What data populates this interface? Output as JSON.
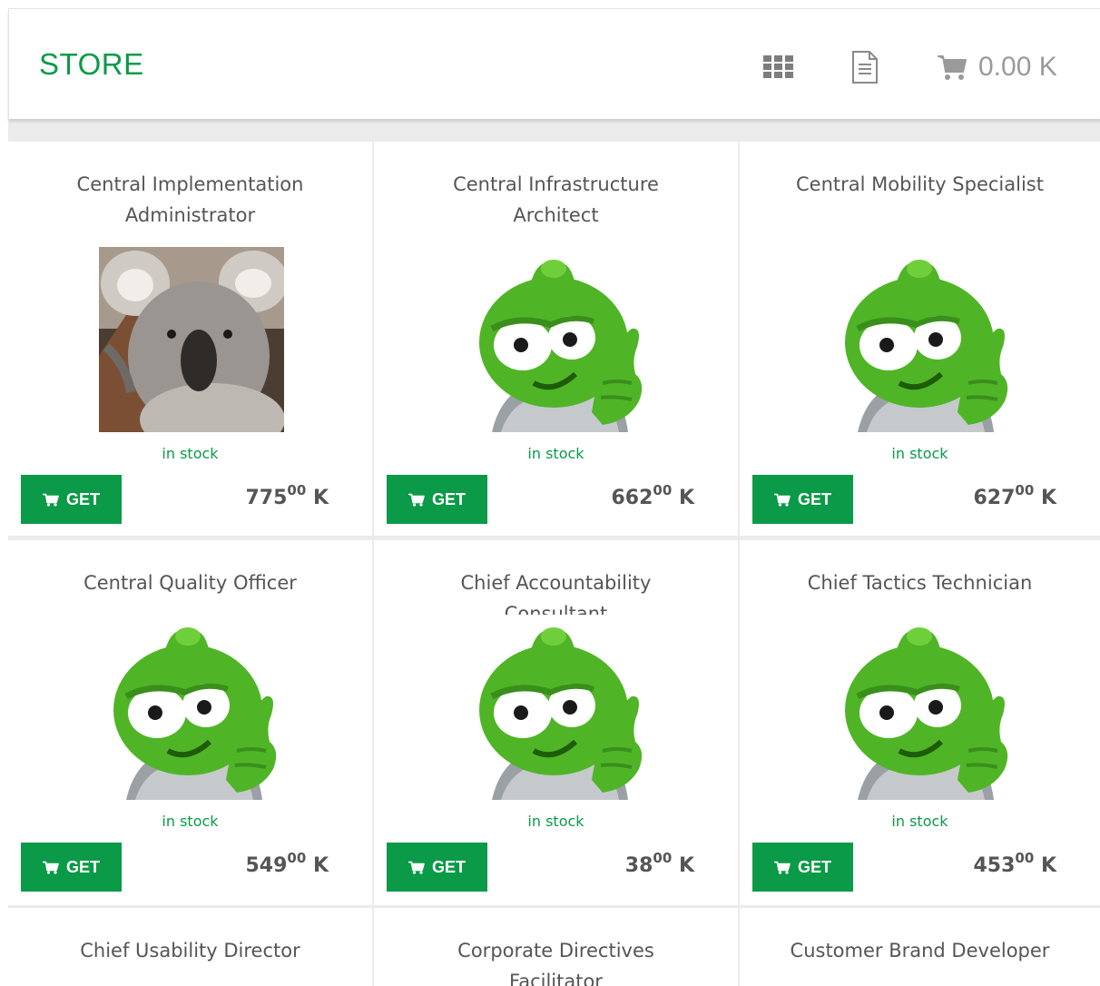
{
  "header": {
    "title": "STORE",
    "icons": [
      "grid-icon",
      "document-icon",
      "cart-icon"
    ],
    "cart_total": "0.00 K"
  },
  "colors": {
    "accent": "#0a9a48",
    "text": "#555555",
    "muted": "#9a9a9a"
  },
  "products": [
    {
      "name": "Central Implementation Administrator",
      "image": "koala",
      "stock": "in stock",
      "button": "GET",
      "price_main": "775",
      "price_cents": "00",
      "currency": "K"
    },
    {
      "name": "Central Infrastructure Architect",
      "image": "green-mascot",
      "stock": "in stock",
      "button": "GET",
      "price_main": "662",
      "price_cents": "00",
      "currency": "K"
    },
    {
      "name": "Central Mobility Specialist",
      "image": "green-mascot",
      "stock": "in stock",
      "button": "GET",
      "price_main": "627",
      "price_cents": "00",
      "currency": "K"
    },
    {
      "name": "Central Quality Officer",
      "image": "green-mascot",
      "stock": "in stock",
      "button": "GET",
      "price_main": "549",
      "price_cents": "00",
      "currency": "K"
    },
    {
      "name": "Chief Accountability Consultant",
      "image": "green-mascot",
      "stock": "in stock",
      "button": "GET",
      "price_main": "38",
      "price_cents": "00",
      "currency": "K"
    },
    {
      "name": "Chief Tactics Technician",
      "image": "green-mascot",
      "stock": "in stock",
      "button": "GET",
      "price_main": "453",
      "price_cents": "00",
      "currency": "K"
    },
    {
      "name": "Chief Usability Director"
    },
    {
      "name": "Corporate Directives Facilitator"
    },
    {
      "name": "Customer Brand Developer"
    }
  ]
}
